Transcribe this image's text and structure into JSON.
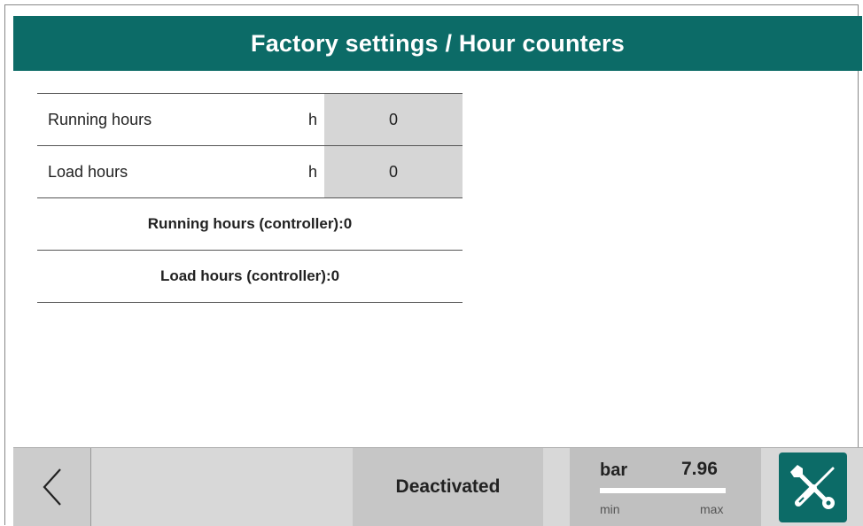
{
  "header": {
    "title": "Factory settings / Hour counters"
  },
  "counters": [
    {
      "label": "Running hours",
      "unit": "h",
      "value": "0"
    },
    {
      "label": "Load hours",
      "unit": "h",
      "value": "0"
    }
  ],
  "controller_info": [
    "Running hours (controller):0",
    "Load hours (controller):0"
  ],
  "footer": {
    "status": "Deactivated",
    "gauge": {
      "unit": "bar",
      "value": "7.96",
      "min_label": "min",
      "max_label": "max",
      "fill_fraction": 1.0
    }
  },
  "icons": {
    "back": "chevron-left-icon",
    "tools": "wrench-screwdriver-icon"
  },
  "colors": {
    "accent": "#0c6b67",
    "value_cell": "#d6d6d6",
    "footer": "#d8d8d8"
  }
}
